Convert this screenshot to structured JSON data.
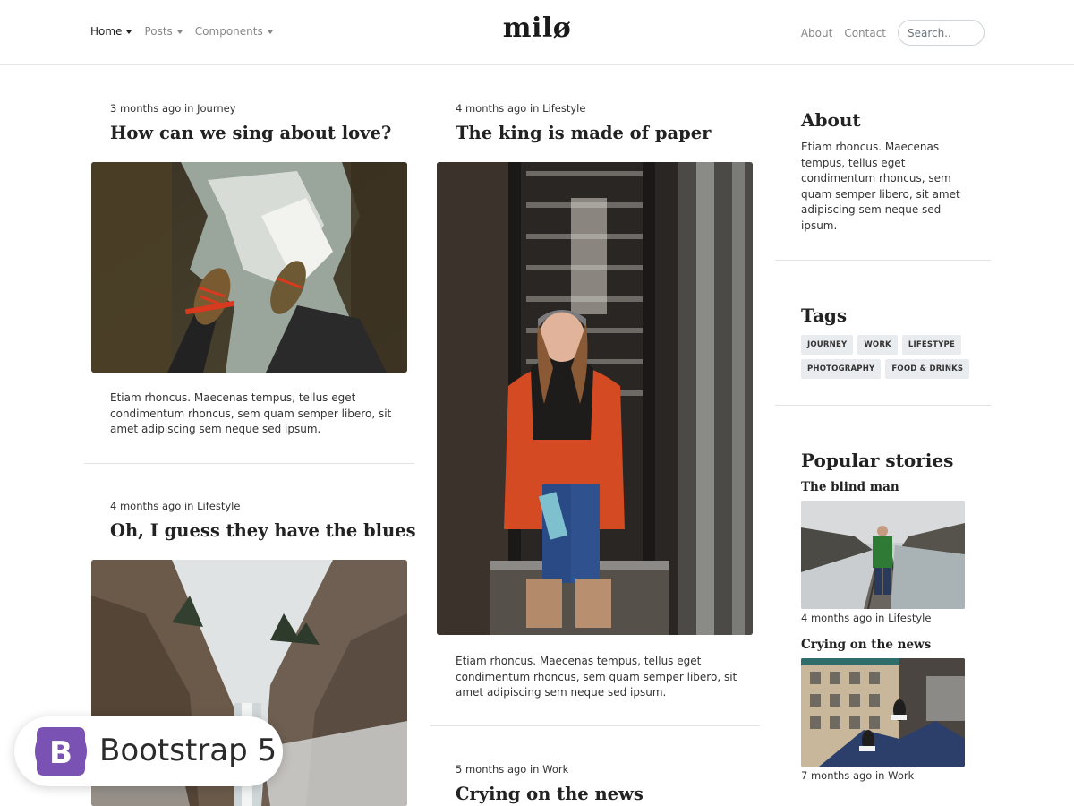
{
  "nav": {
    "items": [
      {
        "label": "Home"
      },
      {
        "label": "Posts"
      },
      {
        "label": "Components"
      }
    ],
    "brand": "milø",
    "right_links": [
      {
        "label": "About"
      },
      {
        "label": "Contact"
      }
    ],
    "search_placeholder": "Search.."
  },
  "posts": [
    {
      "meta": "3 months ago in Journey",
      "title": "How can we sing about love?",
      "excerpt": "Etiam rhoncus. Maecenas tempus, tellus eget condimentum rhoncus, sem quam semper libero, sit amet adipiscing sem neque sed ipsum."
    },
    {
      "meta": "4 months ago in Lifestyle",
      "title": "Oh, I guess they have the blues"
    },
    {
      "meta": "4 months ago in Lifestyle",
      "title": "The king is made of paper",
      "excerpt": "Etiam rhoncus. Maecenas tempus, tellus eget condimentum rhoncus, sem quam semper libero, sit amet adipiscing sem neque sed ipsum."
    },
    {
      "meta": "5 months ago in Work",
      "title": "Crying on the news"
    }
  ],
  "sidebar": {
    "about": {
      "heading": "About",
      "text": "Etiam rhoncus. Maecenas tempus, tellus eget condimentum rhoncus, sem quam semper libero, sit amet adipiscing sem neque sed ipsum."
    },
    "tags": {
      "heading": "Tags",
      "items": [
        "JOURNEY",
        "WORK",
        "LIFESTYPE",
        "PHOTOGRAPHY",
        "FOOD & DRINKS"
      ]
    },
    "popular": {
      "heading": "Popular stories",
      "items": [
        {
          "title": "The blind man",
          "meta": "4 months ago in Lifestyle"
        },
        {
          "title": "Crying on the news",
          "meta": "7 months ago in Work"
        }
      ]
    }
  },
  "badge": {
    "logo_letter": "B",
    "text": "Bootstrap 5",
    "logo_color": "#7952b3"
  }
}
